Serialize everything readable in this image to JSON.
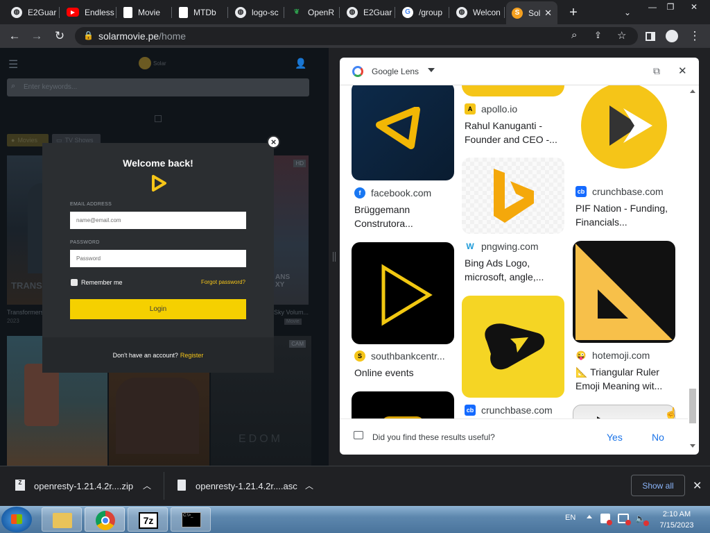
{
  "tabs": [
    {
      "label": "E2Guar",
      "icon": "globe-icon"
    },
    {
      "label": "Endless",
      "icon": "youtube-icon"
    },
    {
      "label": "Movie",
      "icon": "document-icon"
    },
    {
      "label": "MTDb",
      "icon": "document-icon"
    },
    {
      "label": "logo-sc",
      "icon": "globe-icon"
    },
    {
      "label": "OpenR",
      "icon": "leaf-icon"
    },
    {
      "label": "E2Guar",
      "icon": "globe-icon"
    },
    {
      "label": "/group",
      "icon": "google-icon"
    },
    {
      "label": "Welcon",
      "icon": "globe-icon"
    },
    {
      "label": "Sol",
      "icon": "solar-icon",
      "active": true
    }
  ],
  "address": {
    "host": "solarmovie.pe",
    "path": "/home"
  },
  "site": {
    "search_placeholder": "Enter keywords...",
    "tab_movies": "Movies",
    "tab_tv": "TV Shows",
    "posters": [
      {
        "title": "Transformers",
        "meta": "2023",
        "badge": ""
      },
      {
        "title": "Sky Volum...",
        "meta": "Movie",
        "badge": "HD"
      },
      {
        "title": "",
        "meta": "",
        "badge": "CAM"
      }
    ]
  },
  "login": {
    "heading": "Welcome back!",
    "email_label": "EMAIL ADDRESS",
    "email_placeholder": "name@email.com",
    "password_label": "PASSWORD",
    "password_placeholder": "Password",
    "remember": "Remember me",
    "forgot": "Forgot password?",
    "login_button": "Login",
    "no_account": "Don't have an account?",
    "register": "Register",
    "close": "×"
  },
  "lens": {
    "title": "Google Lens",
    "col1": [
      {
        "source": "facebook.com",
        "title": "Brüggemann Construtora..."
      },
      {
        "source": "southbankcentr...",
        "title": "Online events"
      }
    ],
    "col2": [
      {
        "source": "apollo.io",
        "title": "Rahul Kanuganti - Founder and CEO -..."
      },
      {
        "source": "pngwing.com",
        "title": "Bing Ads Logo, microsoft, angle,..."
      },
      {
        "source": "crunchbase.com",
        "title": ""
      }
    ],
    "col3": [
      {
        "source": "crunchbase.com",
        "title": "PIF Nation - Funding, Financials..."
      },
      {
        "source": "hotemoji.com",
        "title": "📐 Triangular Ruler Emoji Meaning wit..."
      }
    ],
    "feedback": "Did you find these results useful?",
    "yes": "Yes",
    "no": "No"
  },
  "downloads": [
    {
      "name": "openresty-1.21.4.2r....zip"
    },
    {
      "name": "openresty-1.21.4.2r....asc"
    }
  ],
  "downloads_show_all": "Show all",
  "tray": {
    "lang": "EN",
    "time": "2:10 AM",
    "date": "7/15/2023"
  },
  "colors": {
    "accent": "#f5c518",
    "lens_blue": "#1a73e8"
  }
}
